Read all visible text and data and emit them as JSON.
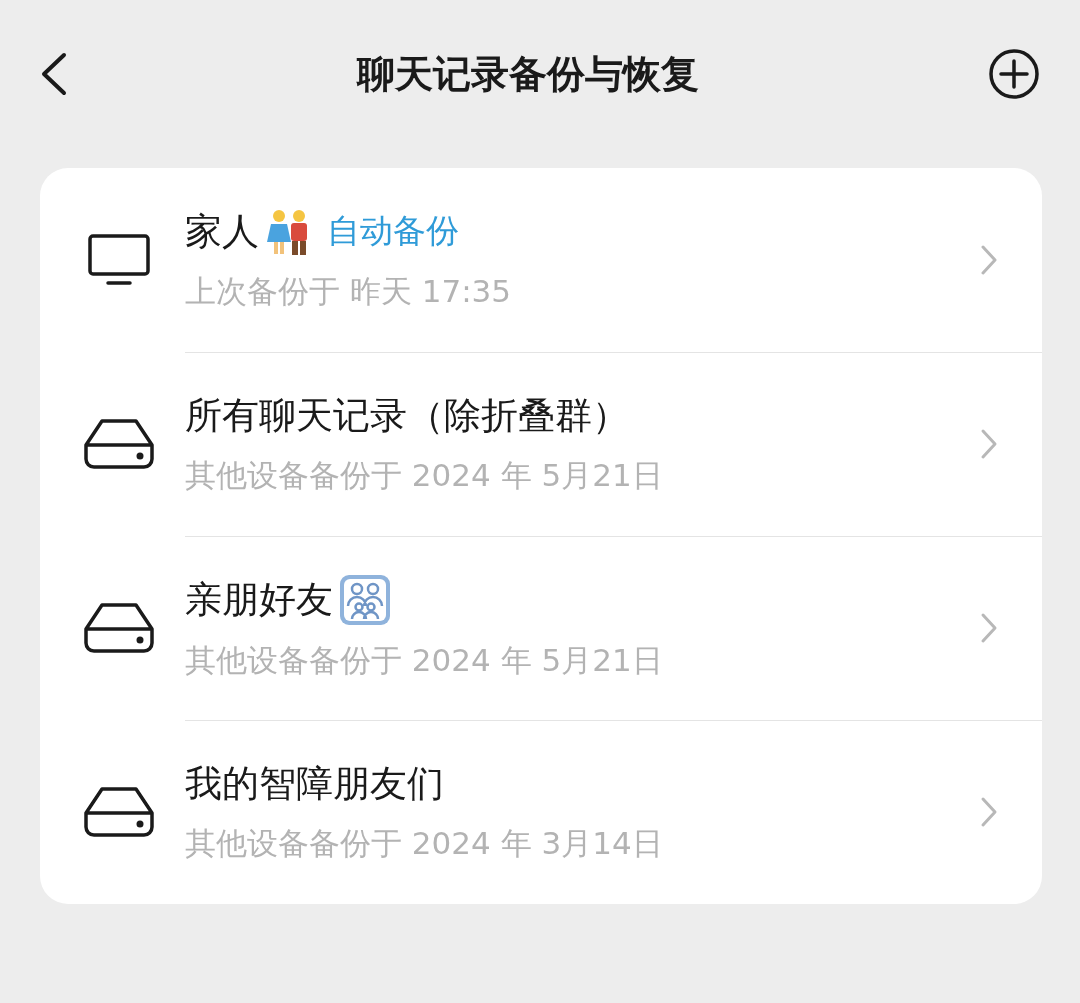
{
  "header": {
    "title": "聊天记录备份与恢复"
  },
  "backups": [
    {
      "kind": "monitor",
      "name": "家人",
      "emblem": {
        "kind": "couple"
      },
      "tag": "自动备份",
      "detail": "上次备份于 昨天 17:35"
    },
    {
      "kind": "drive",
      "name": "所有聊天记录（除折叠群）",
      "detail": "其他设备备份于 2024 年 5月21日"
    },
    {
      "kind": "drive",
      "name": "亲朋好友",
      "emblem": {
        "kind": "family"
      },
      "detail": "其他设备备份于 2024 年 5月21日"
    },
    {
      "kind": "drive",
      "name": "我的智障朋友们",
      "detail": "其他设备备份于 2024 年 3月14日"
    }
  ]
}
